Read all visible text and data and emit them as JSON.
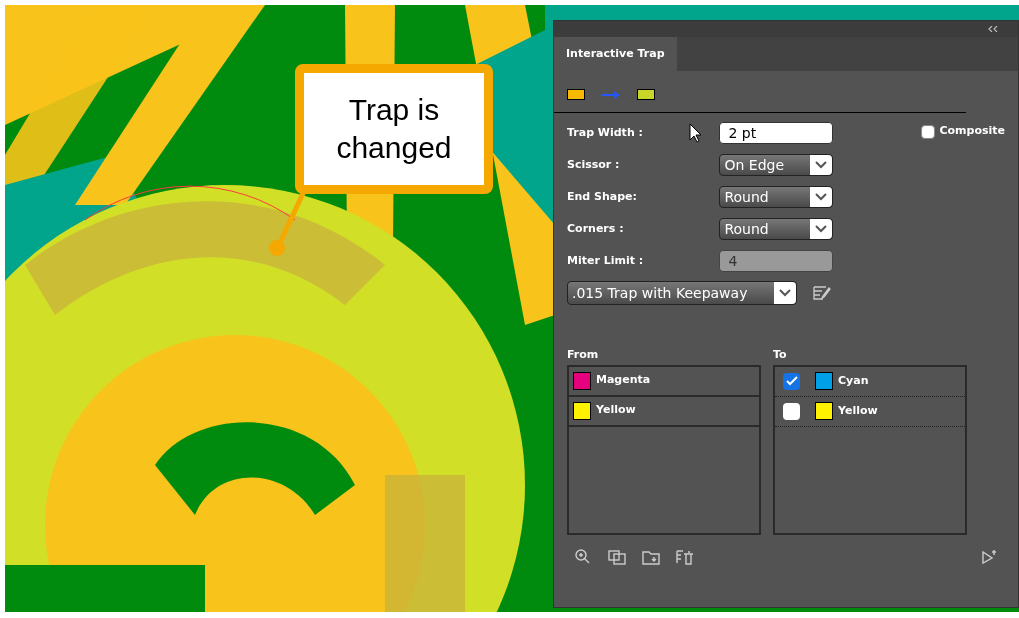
{
  "callout": {
    "text": "Trap is changed"
  },
  "panel": {
    "tab": {
      "label": "Interactive Trap",
      "selected": true
    },
    "trap_swatches": [
      {
        "color": "#f7b800"
      },
      {
        "color": "#c8d62a"
      }
    ],
    "fields": [
      {
        "kind": "text",
        "label": "Trap Width :",
        "value": "2 pt"
      },
      {
        "kind": "select",
        "label": "Scissor :",
        "value": "On Edge"
      },
      {
        "kind": "select",
        "label": "End Shape:",
        "value": "Round"
      },
      {
        "kind": "select",
        "label": "Corners :",
        "value": "Round"
      },
      {
        "kind": "disabled",
        "label": "Miter Limit :",
        "value": "4"
      }
    ],
    "composite": {
      "label": "Composite",
      "checked": false
    },
    "preset": {
      "value": ".015 Trap with Keepaway"
    },
    "from": {
      "heading": "From",
      "items": [
        {
          "name": "Magenta",
          "color": "#e6007e"
        },
        {
          "name": "Yellow",
          "color": "#fff200"
        }
      ]
    },
    "to": {
      "heading": "To",
      "items": [
        {
          "name": "Cyan",
          "color": "#00a0e9",
          "checked": true
        },
        {
          "name": "Yellow",
          "color": "#fff200",
          "checked": false
        }
      ]
    }
  }
}
